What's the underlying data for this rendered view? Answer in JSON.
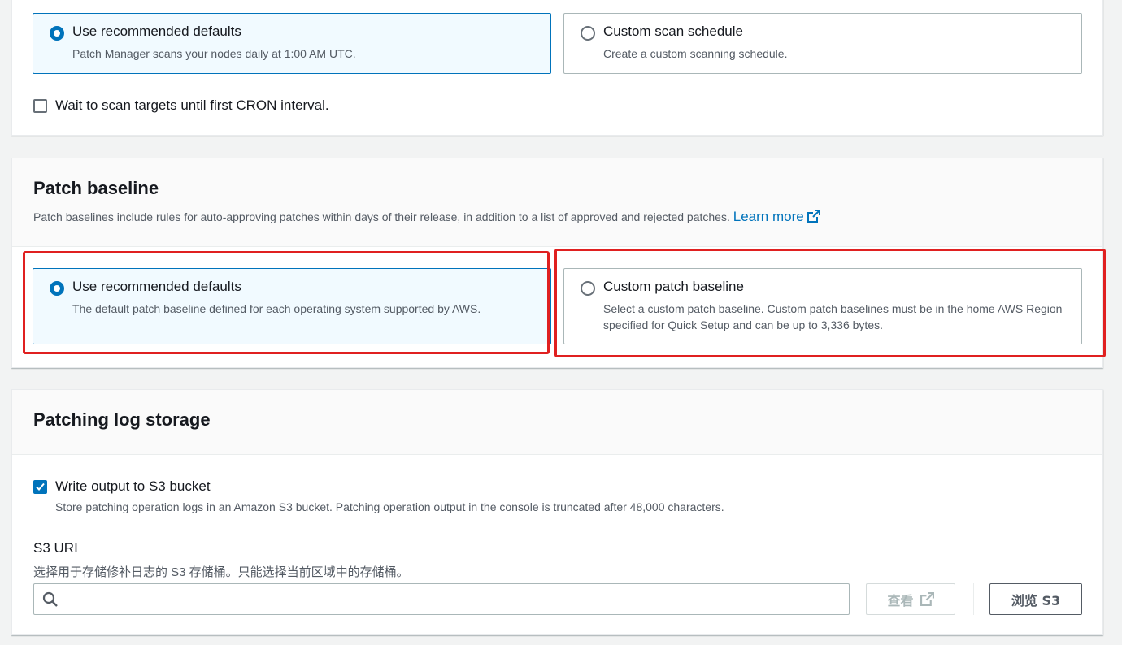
{
  "scan_section": {
    "options": [
      {
        "label": "Use recommended defaults",
        "description": "Patch Manager scans your nodes daily at 1:00 AM UTC.",
        "selected": true
      },
      {
        "label": "Custom scan schedule",
        "description": "Create a custom scanning schedule.",
        "selected": false
      }
    ],
    "wait_checkbox": {
      "label": "Wait to scan targets until first CRON interval.",
      "checked": false
    }
  },
  "baseline_section": {
    "title": "Patch baseline",
    "description": "Patch baselines include rules for auto-approving patches within days of their release, in addition to a list of approved and rejected patches.",
    "learn_more": "Learn more",
    "options": [
      {
        "label": "Use recommended defaults",
        "description": "The default patch baseline defined for each operating system supported by AWS.",
        "selected": true
      },
      {
        "label": "Custom patch baseline",
        "description": "Select a custom patch baseline. Custom patch baselines must be in the home AWS Region specified for Quick Setup and can be up to 3,336 bytes.",
        "selected": false
      }
    ]
  },
  "log_section": {
    "title": "Patching log storage",
    "write_checkbox": {
      "label": "Write output to S3 bucket",
      "description": "Store patching operation logs in an Amazon S3 bucket. Patching operation output in the console is truncated after 48,000 characters.",
      "checked": true
    },
    "s3_uri": {
      "label": "S3 URI",
      "description": "选择用于存储修补日志的 S3 存储桶。只能选择当前区域中的存储桶。",
      "value": "",
      "placeholder": ""
    },
    "view_button": "查看",
    "browse_button": "浏览 S3"
  },
  "colors": {
    "accent": "#0073bb",
    "selected_bg": "#f1faff",
    "highlight": "#e02020"
  }
}
